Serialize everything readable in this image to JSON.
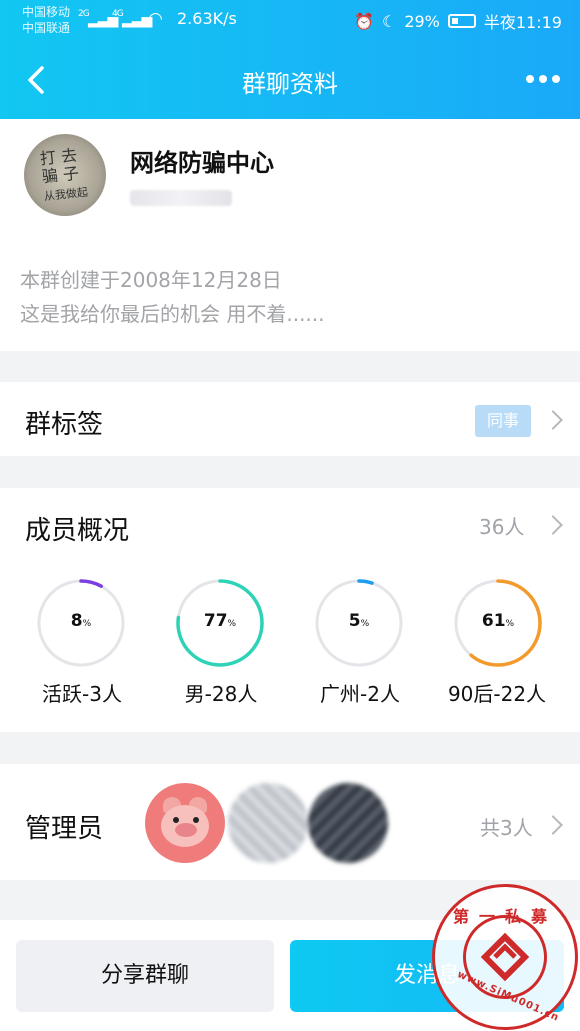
{
  "status": {
    "carrier1": "中国移动",
    "carrier2": "中国联通",
    "net1": "2G",
    "net2": "4G",
    "speed": "2.63K/s",
    "battery": "29%",
    "time": "半夜11:19"
  },
  "nav": {
    "title": "群聊资料"
  },
  "group": {
    "name": "网络防骗中心",
    "created": "本群创建于2008年12月28日",
    "intro": "这是我给你最后的机会  用不着......"
  },
  "tags": {
    "label": "群标签",
    "chip": "同事"
  },
  "members": {
    "label": "成员概况",
    "count": "36人",
    "stats": [
      {
        "value": "8",
        "unit": "%",
        "label": "活跃-3人",
        "fraction": 0.08,
        "color": "#7b3fe4"
      },
      {
        "value": "77",
        "unit": "%",
        "label": "男-28人",
        "fraction": 0.77,
        "color": "#2ed3b7"
      },
      {
        "value": "5",
        "unit": "%",
        "label": "广州-2人",
        "fraction": 0.05,
        "color": "#1e9cf0"
      },
      {
        "value": "61",
        "unit": "%",
        "label": "90后-22人",
        "fraction": 0.61,
        "color": "#f39a2c"
      }
    ]
  },
  "admins": {
    "label": "管理员",
    "count": "共3人"
  },
  "footer": {
    "share": "分享群聊",
    "send": "发消息"
  },
  "watermark": {
    "top": "第一私募",
    "url": "www.SiMu001.cn"
  }
}
